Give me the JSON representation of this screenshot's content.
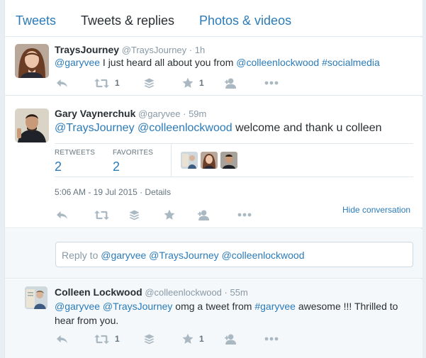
{
  "tabs": [
    {
      "label": "Tweets"
    },
    {
      "label": "Tweets & replies"
    },
    {
      "label": "Photos & videos"
    }
  ],
  "tweets": [
    {
      "name": "TraysJourney",
      "handle": "@TraysJourney",
      "sep": "·",
      "time": "1h",
      "mention1": "@garyvee",
      "text1": " I just heard all about you from ",
      "mention2": "@colleenlockwood",
      "space": " ",
      "hashtag": "#socialmedia",
      "retweet_count": "1",
      "favorite_count": "1"
    },
    {
      "name": "Gary Vaynerchuk",
      "handle": "@garyvee",
      "sep": "·",
      "time": "59m",
      "mention1": "@TraysJourney",
      "space": " ",
      "mention2": "@colleenlockwood",
      "text1": " welcome and thank u colleen",
      "retweets_label": "RETWEETS",
      "retweets_value": "2",
      "favorites_label": "FAVORITES",
      "favorites_value": "2",
      "datetime": "5:06 AM - 19 Jul 2015",
      "details_sep": " · ",
      "details": "Details",
      "hide_conversation": "Hide conversation"
    },
    {
      "name": "Colleen Lockwood",
      "handle": "@colleenlockwood",
      "sep": "·",
      "time": "55m",
      "mention1": "@garyvee",
      "space": " ",
      "mention2": "@TraysJourney",
      "text1": " omg a tweet from ",
      "hashtag": "#garyvee",
      "text2": " awesome !!! Thrilled to hear from you.",
      "retweet_count": "1",
      "favorite_count": "1"
    }
  ],
  "reply": {
    "prefix": "Reply to ",
    "mention1": "@garyvee",
    "mention2": "@TraysJourney",
    "mention3": "@colleenlockwood",
    "space": " "
  },
  "colors": {
    "link": "#2b7bb9",
    "muted": "#8899a6",
    "icon": "#aab8c2",
    "border": "#e1e8ed",
    "background": "#f5f8fa"
  },
  "icons": [
    "reply-icon",
    "retweet-icon",
    "buffer-icon",
    "favorite-icon",
    "follow-icon",
    "more-icon"
  ]
}
